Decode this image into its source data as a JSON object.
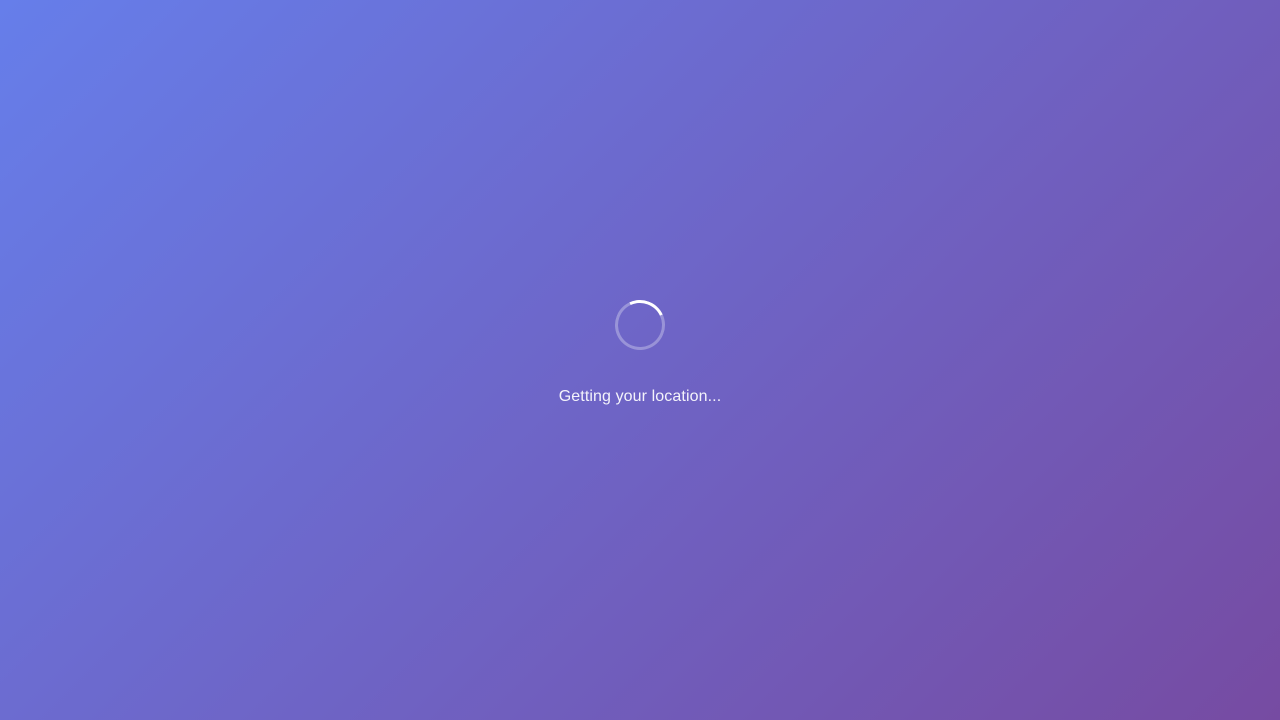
{
  "loading": {
    "spinner_icon": "loading-spinner-icon",
    "message": "Getting your location..."
  },
  "colors": {
    "gradient_start": "#667eea",
    "gradient_end": "#764ba2",
    "spinner": "#ffffff"
  }
}
